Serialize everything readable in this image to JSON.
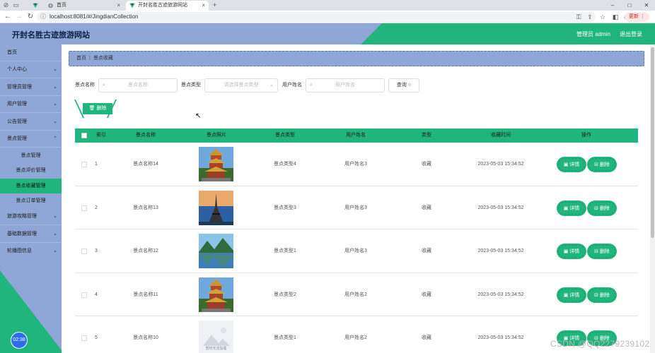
{
  "browser": {
    "tabs": [
      {
        "title": ""
      },
      {
        "title": "首页"
      },
      {
        "title": "开封名胜古迹旅游网站"
      }
    ],
    "new_tab": "+",
    "url": "localhost:8081/#/JingdianCollection",
    "update_label": "更新"
  },
  "header": {
    "title": "开封名胜古迹旅游网站",
    "user": "管理员 admin",
    "logout": "退出登录"
  },
  "sidebar": {
    "items": [
      {
        "label": "首页"
      },
      {
        "label": "个人中心"
      },
      {
        "label": "管理员管理"
      },
      {
        "label": "用户管理"
      },
      {
        "label": "公告管理"
      },
      {
        "label": "景点管理"
      }
    ],
    "sub_items": [
      {
        "label": "景点管理"
      },
      {
        "label": "景点评价管理"
      },
      {
        "label": "景点收藏管理"
      },
      {
        "label": "景点订单管理"
      }
    ],
    "items_after": [
      {
        "label": "旅游攻略管理"
      },
      {
        "label": "基础数据管理"
      },
      {
        "label": "轮播图信息"
      }
    ],
    "clock": "02:38"
  },
  "breadcrumb": {
    "home": "首页",
    "current": "景点收藏"
  },
  "search": {
    "name_label": "景点名称",
    "name_placeholder": "景点名称",
    "type_label": "景点类型",
    "type_placeholder": "请选择景点类型",
    "user_label": "用户姓名",
    "user_placeholder": "用户姓名",
    "button": "查询"
  },
  "delete_button": "删除",
  "table": {
    "headers": [
      "索引",
      "景点名称",
      "景点照片",
      "景点类型",
      "用户姓名",
      "类型",
      "收藏时间",
      "操作"
    ],
    "rows": [
      {
        "index": "1",
        "name": "景点名称14",
        "image": "pagoda",
        "type": "景点类型4",
        "user": "用户姓名3",
        "kind": "收藏",
        "time": "2023-05-03 15:34:52"
      },
      {
        "index": "2",
        "name": "景点名称13",
        "image": "tower",
        "type": "景点类型3",
        "user": "用户姓名3",
        "kind": "收藏",
        "time": "2023-05-03 15:34:52"
      },
      {
        "index": "3",
        "name": "景点名称12",
        "image": "lake",
        "type": "景点类型1",
        "user": "用户姓名3",
        "kind": "收藏",
        "time": "2023-05-03 15:34:52"
      },
      {
        "index": "4",
        "name": "景点名称11",
        "image": "pagoda",
        "type": "景点类型2",
        "user": "用户姓名2",
        "kind": "收藏",
        "time": "2023-05-03 15:34:52"
      },
      {
        "index": "5",
        "name": "景点名称10",
        "image": "placeholder",
        "image_caption": "暂时无法加载",
        "type": "景点类型1",
        "user": "用户姓名2",
        "kind": "收藏",
        "time": "2023-05-03 15:34:52"
      }
    ],
    "detail_label": "详情",
    "delete_label": "删除"
  },
  "watermark": "CSDN @QQ2279239102",
  "colors": {
    "accent": "#21b57e",
    "sidebar": "#8fa7d6",
    "title": "#0c2244"
  }
}
